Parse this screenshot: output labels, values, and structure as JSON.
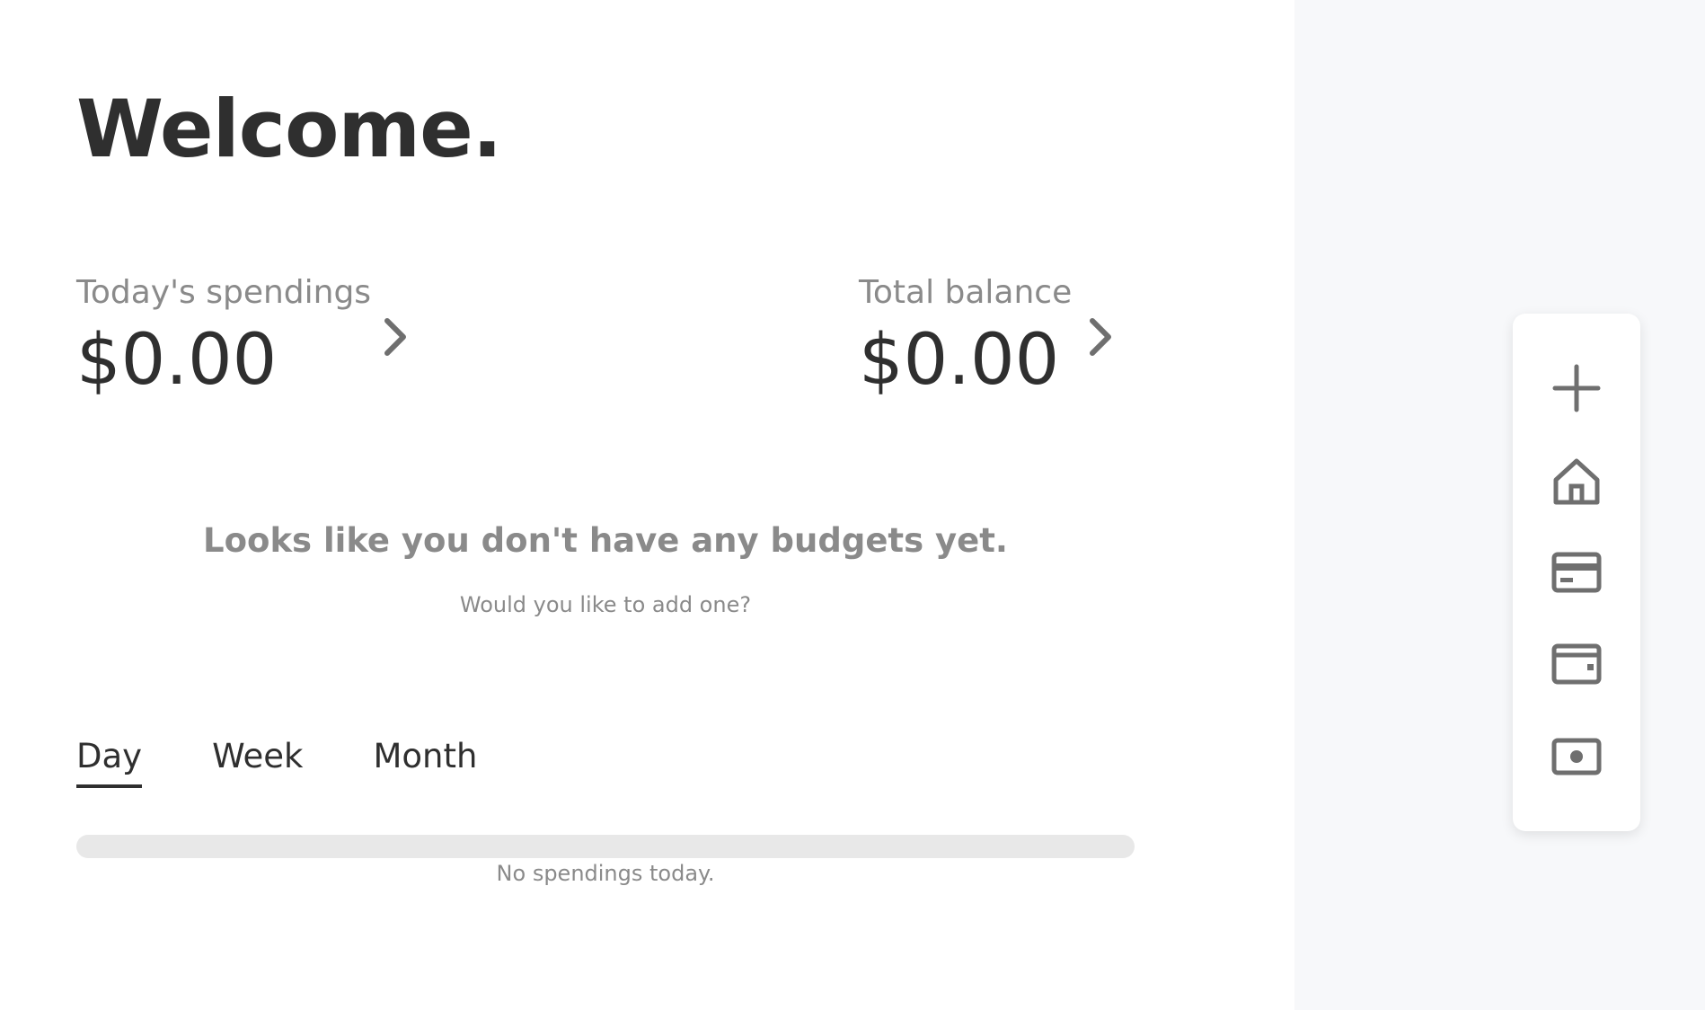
{
  "greeting": "Welcome.",
  "stats": {
    "today": {
      "label": "Today's spendings",
      "value": "$0.00"
    },
    "total": {
      "label": "Total balance",
      "value": "$0.00"
    }
  },
  "budgets_empty": {
    "title": "Looks like you don't have any budgets yet.",
    "subtitle": "Would you like to add one?"
  },
  "tabs": [
    {
      "label": "Day",
      "active": true
    },
    {
      "label": "Week",
      "active": false
    },
    {
      "label": "Month",
      "active": false
    }
  ],
  "spending_bar": {
    "fill": 0,
    "note": "No spendings today."
  },
  "dock": {
    "items": [
      {
        "icon": "plus-icon"
      },
      {
        "icon": "home-icon"
      },
      {
        "icon": "credit-card-icon"
      },
      {
        "icon": "wallet-icon"
      },
      {
        "icon": "cash-icon"
      }
    ]
  },
  "colors": {
    "text": "#2f2f2f",
    "muted": "#8a8a8a",
    "icon": "#6f6f6f",
    "panel": "#ffffff",
    "background": "#f7f8fa",
    "track": "#e8e8e8"
  }
}
